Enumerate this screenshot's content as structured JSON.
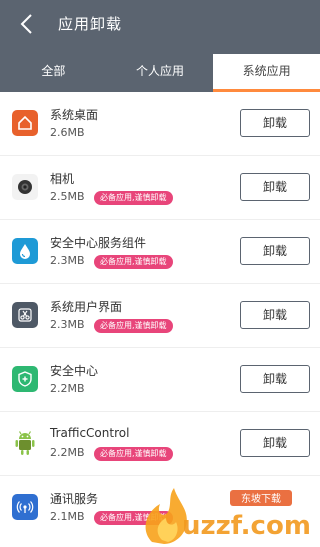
{
  "header": {
    "title": "应用卸载",
    "tabs": [
      {
        "label": "全部",
        "active": false
      },
      {
        "label": "个人应用",
        "active": false
      },
      {
        "label": "系统应用",
        "active": true
      }
    ]
  },
  "colors": {
    "header_bg": "#5b6470",
    "tab_indicator": "#ff8a3d",
    "warning_badge": "#e8457a"
  },
  "apps": [
    {
      "name": "系统桌面",
      "size": "2.6MB",
      "badge": "",
      "button": "卸载",
      "icon": "home-icon"
    },
    {
      "name": "相机",
      "size": "2.5MB",
      "badge": "必备应用,谨慎卸载",
      "button": "卸载",
      "icon": "camera-icon"
    },
    {
      "name": "安全中心服务组件",
      "size": "2.3MB",
      "badge": "必备应用,谨慎卸载",
      "button": "卸载",
      "icon": "water-drop-icon"
    },
    {
      "name": "系统用户界面",
      "size": "2.3MB",
      "badge": "必备应用,谨慎卸载",
      "button": "卸载",
      "icon": "scissors-icon"
    },
    {
      "name": "安全中心",
      "size": "2.2MB",
      "badge": "",
      "button": "卸载",
      "icon": "shield-icon"
    },
    {
      "name": "TrafficControl",
      "size": "2.2MB",
      "badge": "必备应用,谨慎卸载",
      "button": "卸载",
      "icon": "android-icon"
    },
    {
      "name": "通讯服务",
      "size": "2.1MB",
      "badge": "必备应用,谨慎卸载",
      "button": "",
      "icon": "signal-icon"
    }
  ],
  "watermark": {
    "badge": "东坡下载",
    "site": "uzzf.com"
  }
}
